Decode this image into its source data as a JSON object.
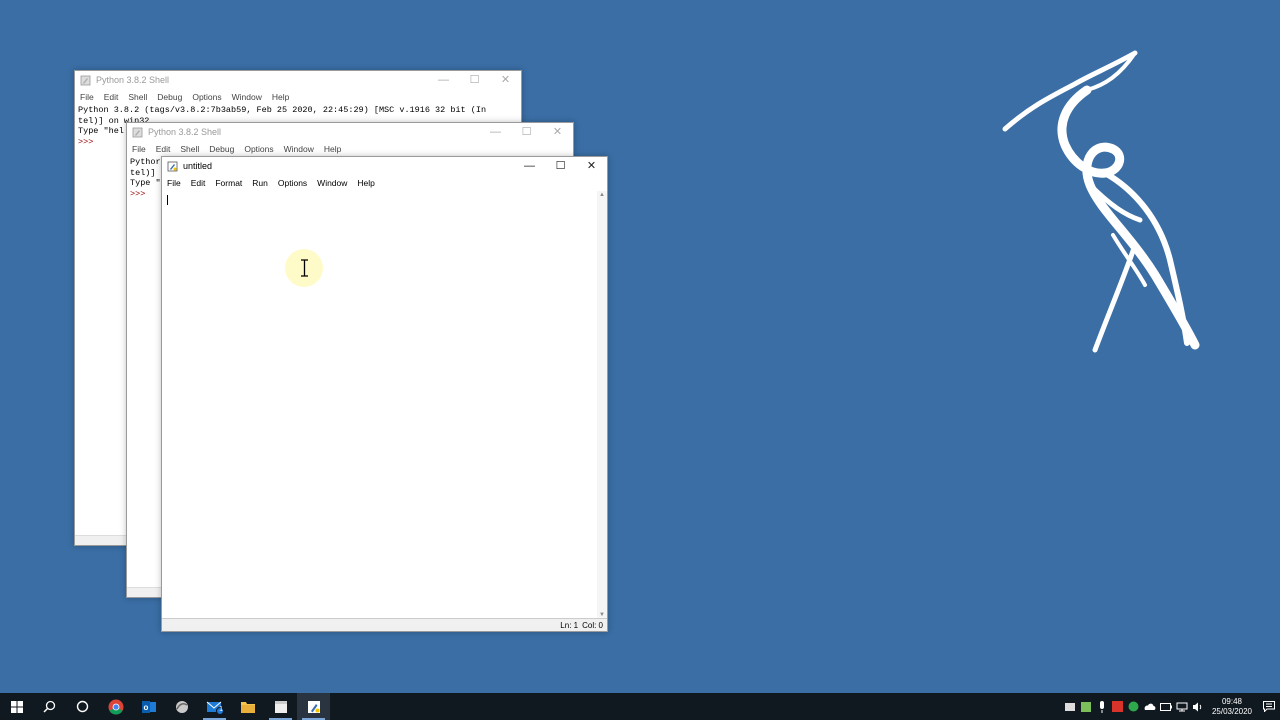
{
  "shell_back": {
    "title": "Python 3.8.2 Shell",
    "menus": [
      "File",
      "Edit",
      "Shell",
      "Debug",
      "Options",
      "Window",
      "Help"
    ],
    "line1": "Python 3.8.2 (tags/v3.8.2:7b3ab59, Feb 25 2020, 22:45:29) [MSC v.1916 32 bit (In",
    "line2": "tel)] on win32",
    "line3": "Type \"hel",
    "prompt": ">>>"
  },
  "shell_mid": {
    "title": "Python 3.8.2 Shell",
    "menus": [
      "File",
      "Edit",
      "Shell",
      "Debug",
      "Options",
      "Window",
      "Help"
    ],
    "line1": "Pythor",
    "line2": "tel)]",
    "line3": "Type \"",
    "prompt": ">>>"
  },
  "editor": {
    "title": "untitled",
    "menus": [
      "File",
      "Edit",
      "Format",
      "Run",
      "Options",
      "Window",
      "Help"
    ],
    "status_line": "Ln: 1",
    "status_col": "Col: 0"
  },
  "window_buttons": {
    "minimize": "—",
    "maximize": "☐",
    "close": "✕"
  },
  "taskbar": {
    "time": "09:48",
    "date": "25/03/2020",
    "icons": [
      "windows-start-icon",
      "search-icon",
      "cortana-icon",
      "chrome-icon",
      "outlook-icon",
      "vpn-icon",
      "mail-icon",
      "file-explorer-icon",
      "idle-shell-icon",
      "idle-editor-icon"
    ],
    "outlook_badge": "1"
  },
  "colors": {
    "desktop": "#3a6ea5",
    "taskbar": "#101820",
    "prompt": "#990000"
  }
}
